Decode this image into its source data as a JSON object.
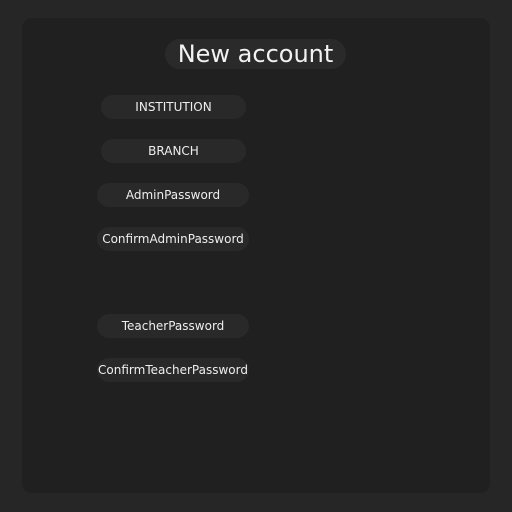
{
  "form": {
    "title": "New account",
    "fields": [
      {
        "placeholder": "INSTITUTION"
      },
      {
        "placeholder": "BRANCH"
      },
      {
        "placeholder": "AdminPassword"
      },
      {
        "placeholder": "ConfirmAdminPassword"
      },
      {
        "placeholder": "TeacherPassword"
      },
      {
        "placeholder": "ConfirmTeacherPassword"
      }
    ]
  }
}
